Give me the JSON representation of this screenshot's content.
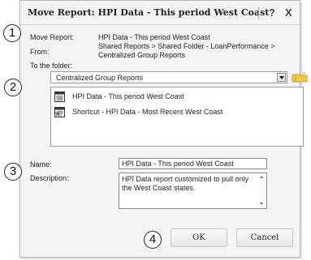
{
  "dialog": {
    "title": "Move Report: HPI Data - This period West Coast",
    "help_label": "?",
    "close_label": "X"
  },
  "callouts": [
    "1",
    "2",
    "3",
    "4"
  ],
  "info": {
    "move_report_label": "Move Report:",
    "move_report_value": "HPI Data - This period West Coast",
    "from_label": "From:",
    "from_line1": "Shared Reports > Shared Folder - LoanPerformance >",
    "from_line2": "Centralized Group Reports",
    "to_folder_label": "To the folder:"
  },
  "folder_select": {
    "selected": "Centralized Group Reports"
  },
  "toolbar": {
    "up_folder_icon": "folder-up-icon",
    "new_folder_icon": "new-folder-icon"
  },
  "items": [
    {
      "label": "HPI Data - This period West Coast",
      "icon": "report-icon"
    },
    {
      "label": "Shortcut - HPI Data - Most Recent West Coast",
      "icon": "report-shortcut-icon"
    }
  ],
  "form": {
    "name_label": "Name:",
    "name_value": "HPI Data - This period West Coast",
    "description_label": "Description:",
    "description_value": "HPI Data report customized to pull only the West Coast states."
  },
  "buttons": {
    "ok_label": "OK",
    "cancel_label": "Cancel"
  },
  "colors": {
    "dialog_bg": "#f4f4f4",
    "folder_yellow": "#f2c94c",
    "arrow_green": "#3a9a2a"
  }
}
